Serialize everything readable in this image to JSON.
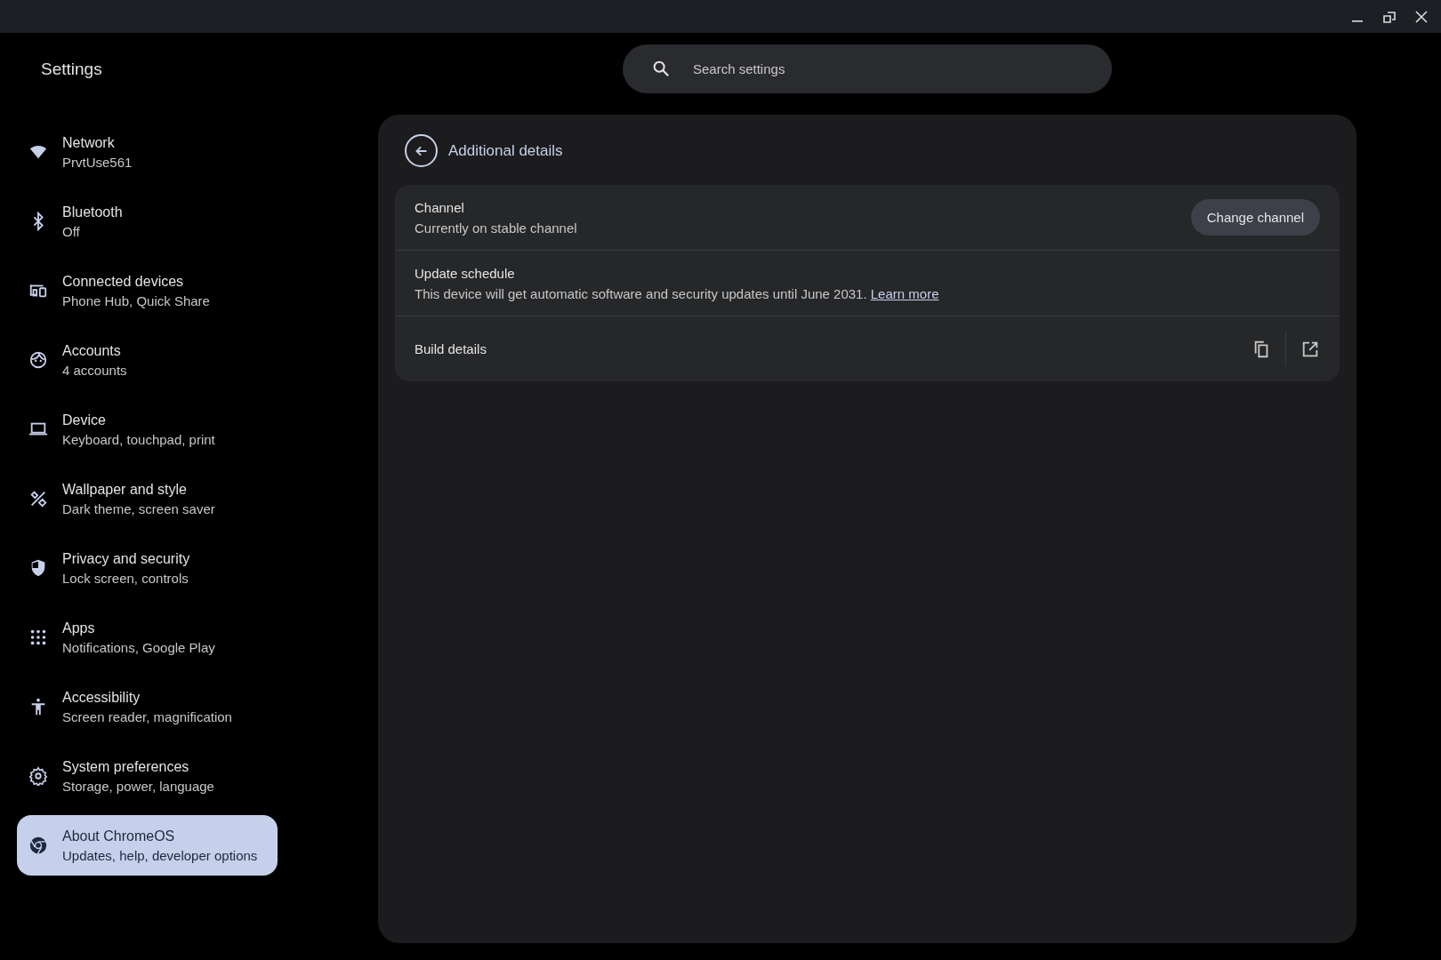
{
  "window": {
    "title": "Settings"
  },
  "search": {
    "placeholder": "Search settings"
  },
  "sidebar": {
    "items": [
      {
        "label": "Network",
        "sublabel": "PrvtUse561",
        "selected": false
      },
      {
        "label": "Bluetooth",
        "sublabel": "Off",
        "selected": false
      },
      {
        "label": "Connected devices",
        "sublabel": "Phone Hub, Quick Share",
        "selected": false
      },
      {
        "label": "Accounts",
        "sublabel": "4 accounts",
        "selected": false
      },
      {
        "label": "Device",
        "sublabel": "Keyboard, touchpad, print",
        "selected": false
      },
      {
        "label": "Wallpaper and style",
        "sublabel": "Dark theme, screen saver",
        "selected": false
      },
      {
        "label": "Privacy and security",
        "sublabel": "Lock screen, controls",
        "selected": false
      },
      {
        "label": "Apps",
        "sublabel": "Notifications, Google Play",
        "selected": false
      },
      {
        "label": "Accessibility",
        "sublabel": "Screen reader, magnification",
        "selected": false
      },
      {
        "label": "System preferences",
        "sublabel": "Storage, power, language",
        "selected": false
      },
      {
        "label": "About ChromeOS",
        "sublabel": "Updates, help, developer options",
        "selected": true
      }
    ]
  },
  "page": {
    "title": "Additional details",
    "rows": [
      {
        "kind": "button",
        "title": "Channel",
        "description": "Currently on stable channel",
        "button": "Change channel"
      },
      {
        "kind": "link",
        "title": "Update schedule",
        "description": "This device will get automatic software and security updates until June 2031.",
        "link": "Learn more"
      },
      {
        "kind": "actions",
        "title": "Build details"
      }
    ]
  }
}
